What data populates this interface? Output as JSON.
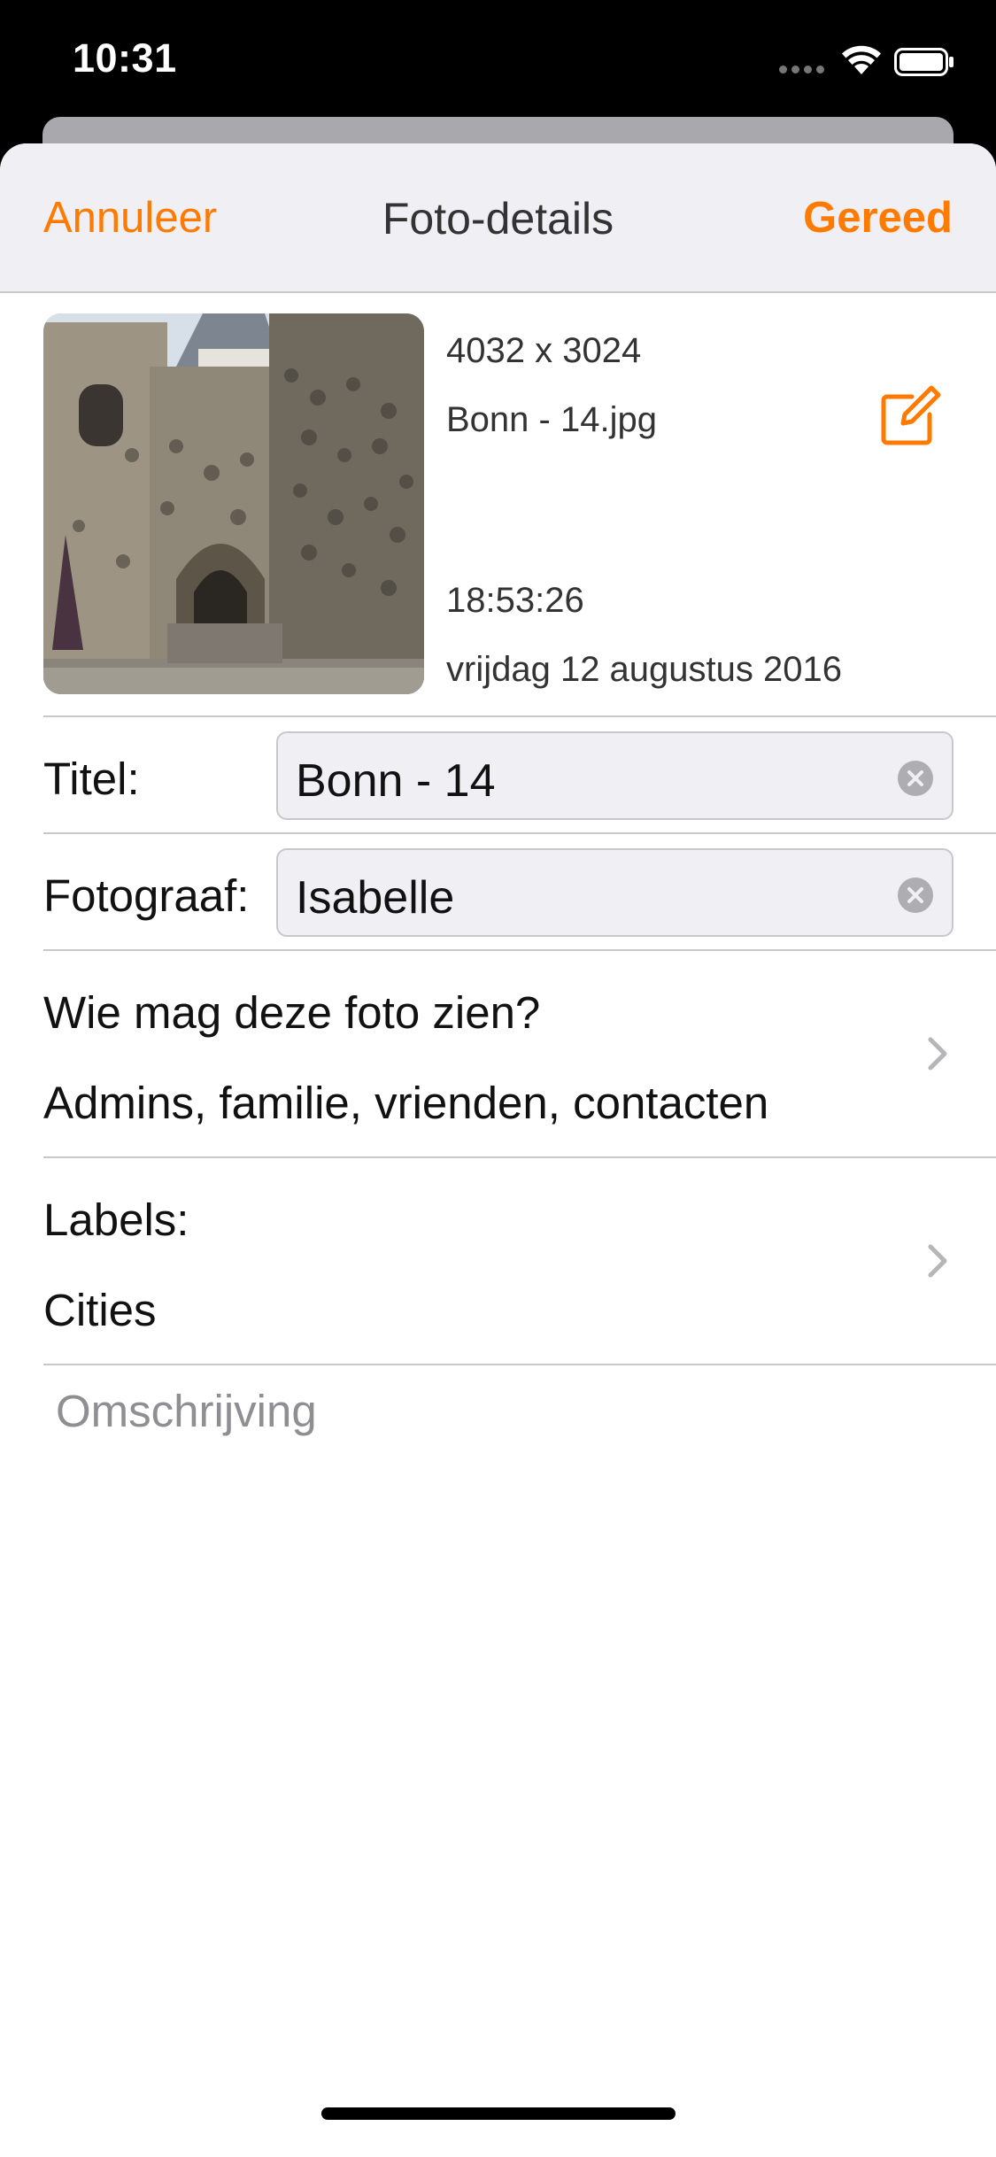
{
  "status_bar": {
    "time": "10:31"
  },
  "nav": {
    "cancel_label": "Annuleer",
    "title": "Foto-details",
    "done_label": "Gereed"
  },
  "photo": {
    "dimensions": "4032 x 3024",
    "filename": "Bonn - 14.jpg",
    "time": "18:53:26",
    "date": "vrijdag 12 augustus 2016"
  },
  "fields": {
    "title": {
      "label": "Titel:",
      "value": "Bonn - 14"
    },
    "photographer": {
      "label": "Fotograaf:",
      "value": "Isabelle"
    }
  },
  "privacy": {
    "label": "Wie mag deze foto zien?",
    "value": "Admins, familie, vrienden, contacten"
  },
  "tags": {
    "label": "Labels:",
    "value": "Cities"
  },
  "description": {
    "placeholder": "Omschrijving"
  },
  "colors": {
    "accent": "#ff7a00",
    "nav_background": "#efeff4",
    "separator": "#c8c8cc"
  },
  "icons": [
    "wifi-icon",
    "battery-icon",
    "edit-icon",
    "clear-icon",
    "chevron-right-icon"
  ]
}
